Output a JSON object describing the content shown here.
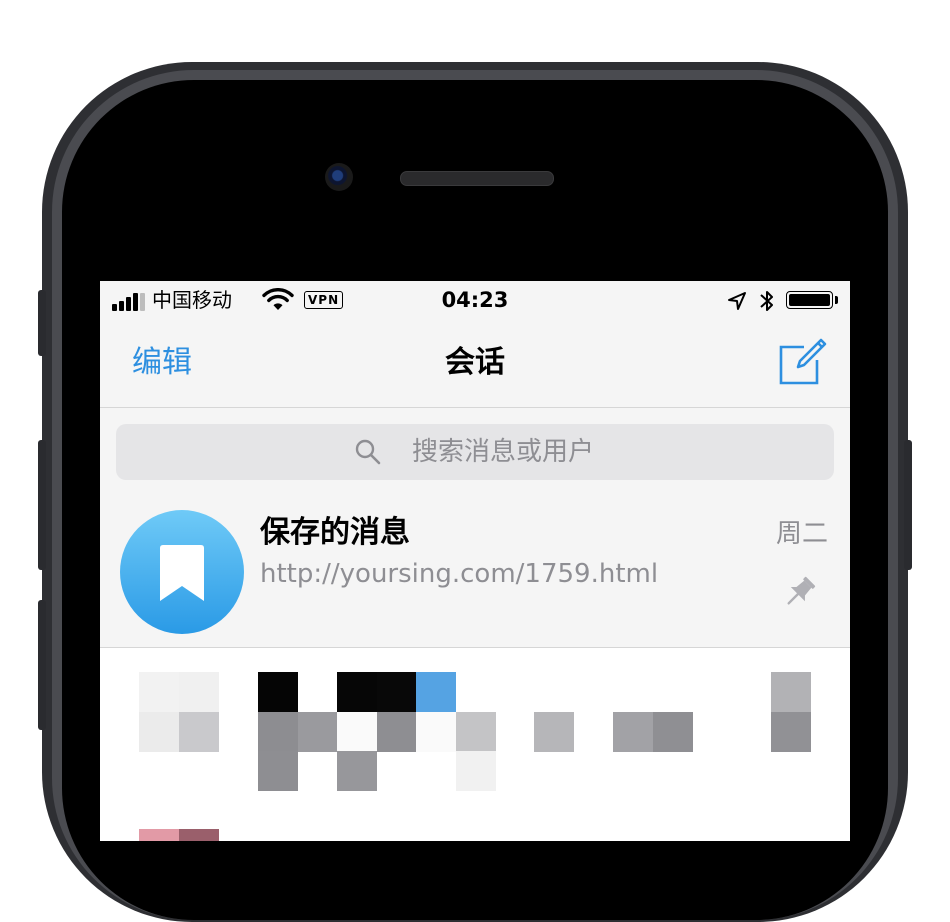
{
  "status_bar": {
    "carrier": "中国移动",
    "vpn_label": "VPN",
    "time": "04:23",
    "battery_level": 1.0,
    "icons": [
      "signal-icon",
      "wifi-icon",
      "location-icon",
      "bluetooth-icon",
      "battery-icon"
    ]
  },
  "nav": {
    "edit_label": "编辑",
    "title": "会话",
    "compose_icon": "compose-icon"
  },
  "search": {
    "placeholder": "搜索消息或用户"
  },
  "chats": [
    {
      "title": "保存的消息",
      "preview": "http://yoursing.com/1759.html",
      "time": "周二",
      "avatar_icon": "bookmark-icon",
      "pinned": true
    }
  ],
  "colors": {
    "accent": "#2d8fe0",
    "avatar_top": "#6fcaf7",
    "avatar_bottom": "#2a9ae6",
    "secondary_text": "#8e8e93",
    "screen_bg": "#f5f5f5"
  }
}
